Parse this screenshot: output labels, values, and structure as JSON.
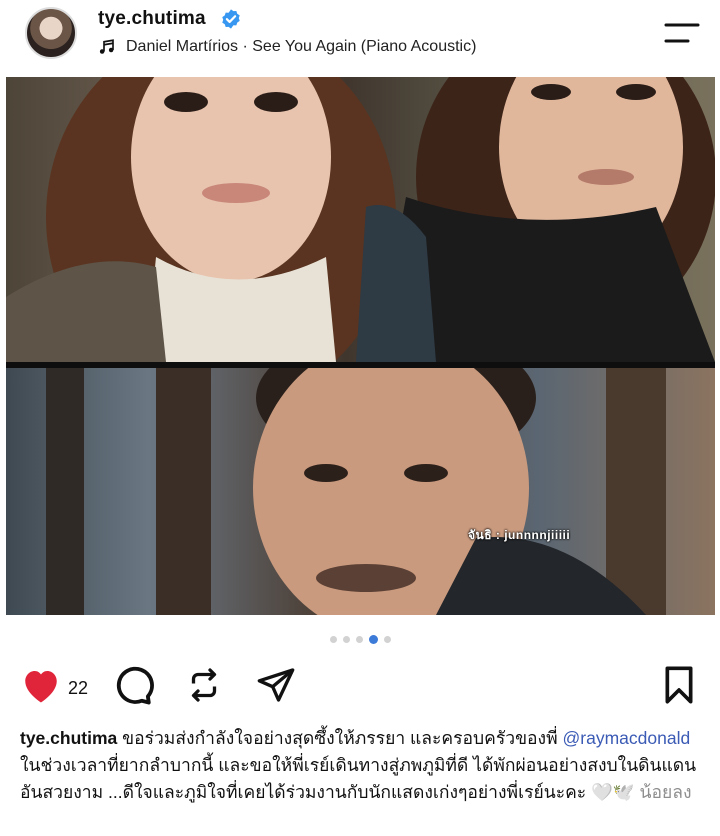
{
  "post": {
    "username": "tye.chutima",
    "music": "Daniel Martírios · See You Again (Piano Acoustic)"
  },
  "photo": {
    "overlay_caption": "จันธิ : junnnnjiiiii",
    "carousel_total": 5,
    "carousel_active": 4
  },
  "actions": {
    "like_count": "22"
  },
  "caption": {
    "username": "tye.chutima",
    "text_part1": " ขอร่วมส่งกำลังใจอย่างสุดซึ้งให้ภรรยา และครอบครัวของพี่ ",
    "mention": "@raymacdonald",
    "text_part2": " ในช่วงเวลาที่ยากลำบากนี้ และขอให้พี่เรย์เดินทางสู่ภพภูมิที่ดี ได้พักผ่อนอย่างสงบในดินแดนอันสวยงาม ...ดีใจและภูมิใจที่เคยได้ร่วมงานกับนักแสดงเก่งๆอย่างพี่เรย์นะคะ ",
    "emoji": "🤍🕊️",
    "less_label": " น้อยลง"
  },
  "colors": {
    "like": "#e0243a",
    "verified": "#3897f0",
    "mention": "#3b5bb5",
    "carousel_active": "#3d7bd8"
  }
}
